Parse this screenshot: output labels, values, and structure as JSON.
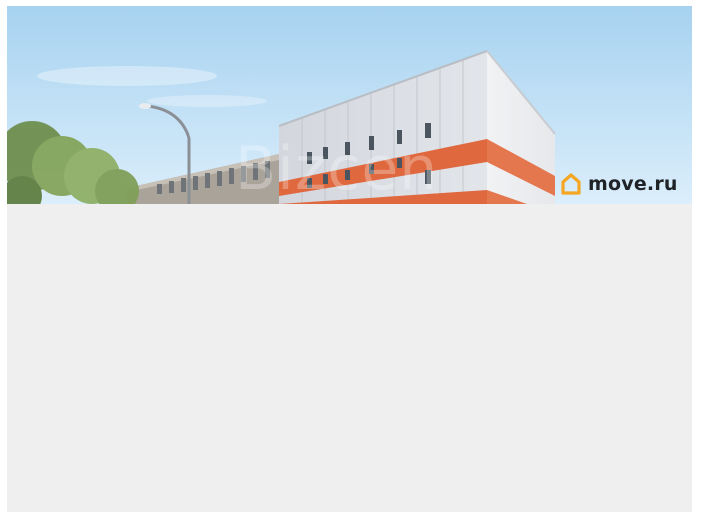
{
  "listing_image": {
    "watermark_text": "Bizcen",
    "brand": {
      "name": "move.ru",
      "icon": "house-outline-icon",
      "icon_color": "#f5a623",
      "text_color": "#1f2328"
    }
  },
  "colors": {
    "sky": "#a9d2ef",
    "facade": "#d9dde2",
    "stripe": "#e0683f",
    "placeholder_bg": "#efefef"
  }
}
